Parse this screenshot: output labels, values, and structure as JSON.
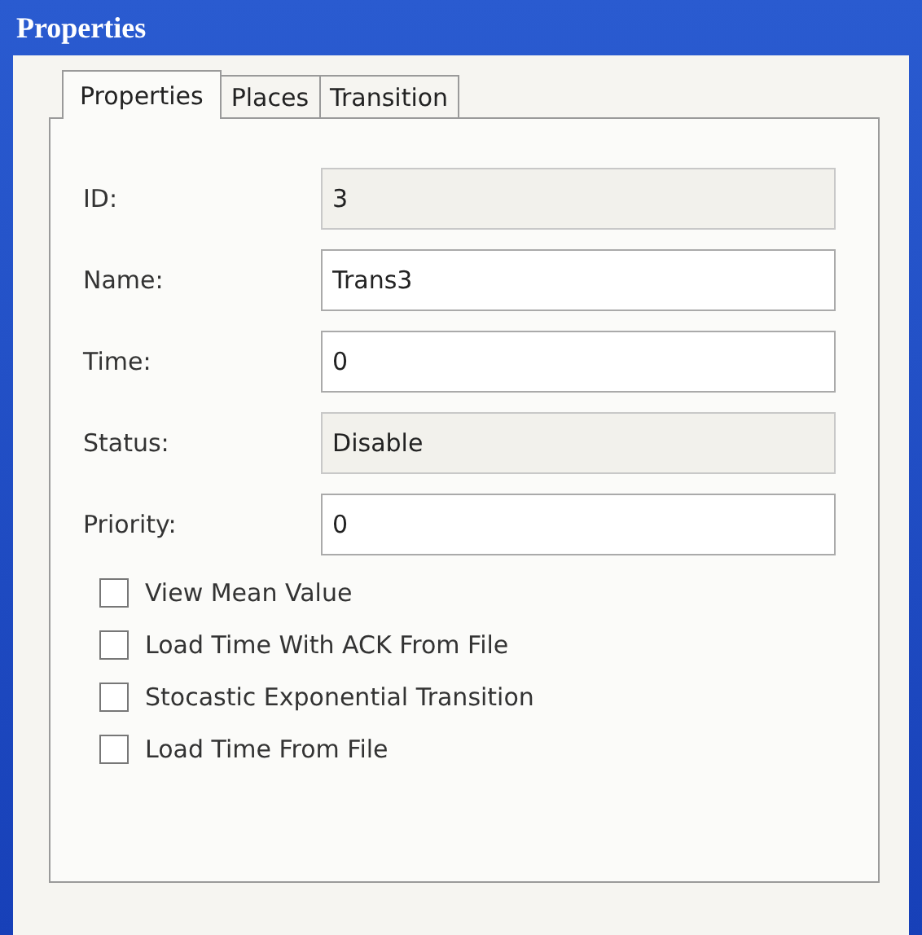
{
  "window": {
    "title": "Properties"
  },
  "tabs": [
    {
      "label": "Properties",
      "selected": true
    },
    {
      "label": "Places",
      "selected": false
    },
    {
      "label": "Transition",
      "selected": false
    }
  ],
  "fields": [
    {
      "label": "ID:",
      "value": "3",
      "disabled": true
    },
    {
      "label": "Name:",
      "value": "Trans3",
      "disabled": false
    },
    {
      "label": "Time:",
      "value": "0",
      "disabled": false
    },
    {
      "label": "Status:",
      "value": "Disable",
      "disabled": true
    },
    {
      "label": "Priority:",
      "value": "0",
      "disabled": false
    }
  ],
  "options": [
    {
      "label": "View Mean Value",
      "checked": false
    },
    {
      "label": "Load Time With ACK From File",
      "checked": false
    },
    {
      "label": "Stocastic Exponential Transition",
      "checked": false
    },
    {
      "label": "Load Time From File",
      "checked": false
    }
  ]
}
